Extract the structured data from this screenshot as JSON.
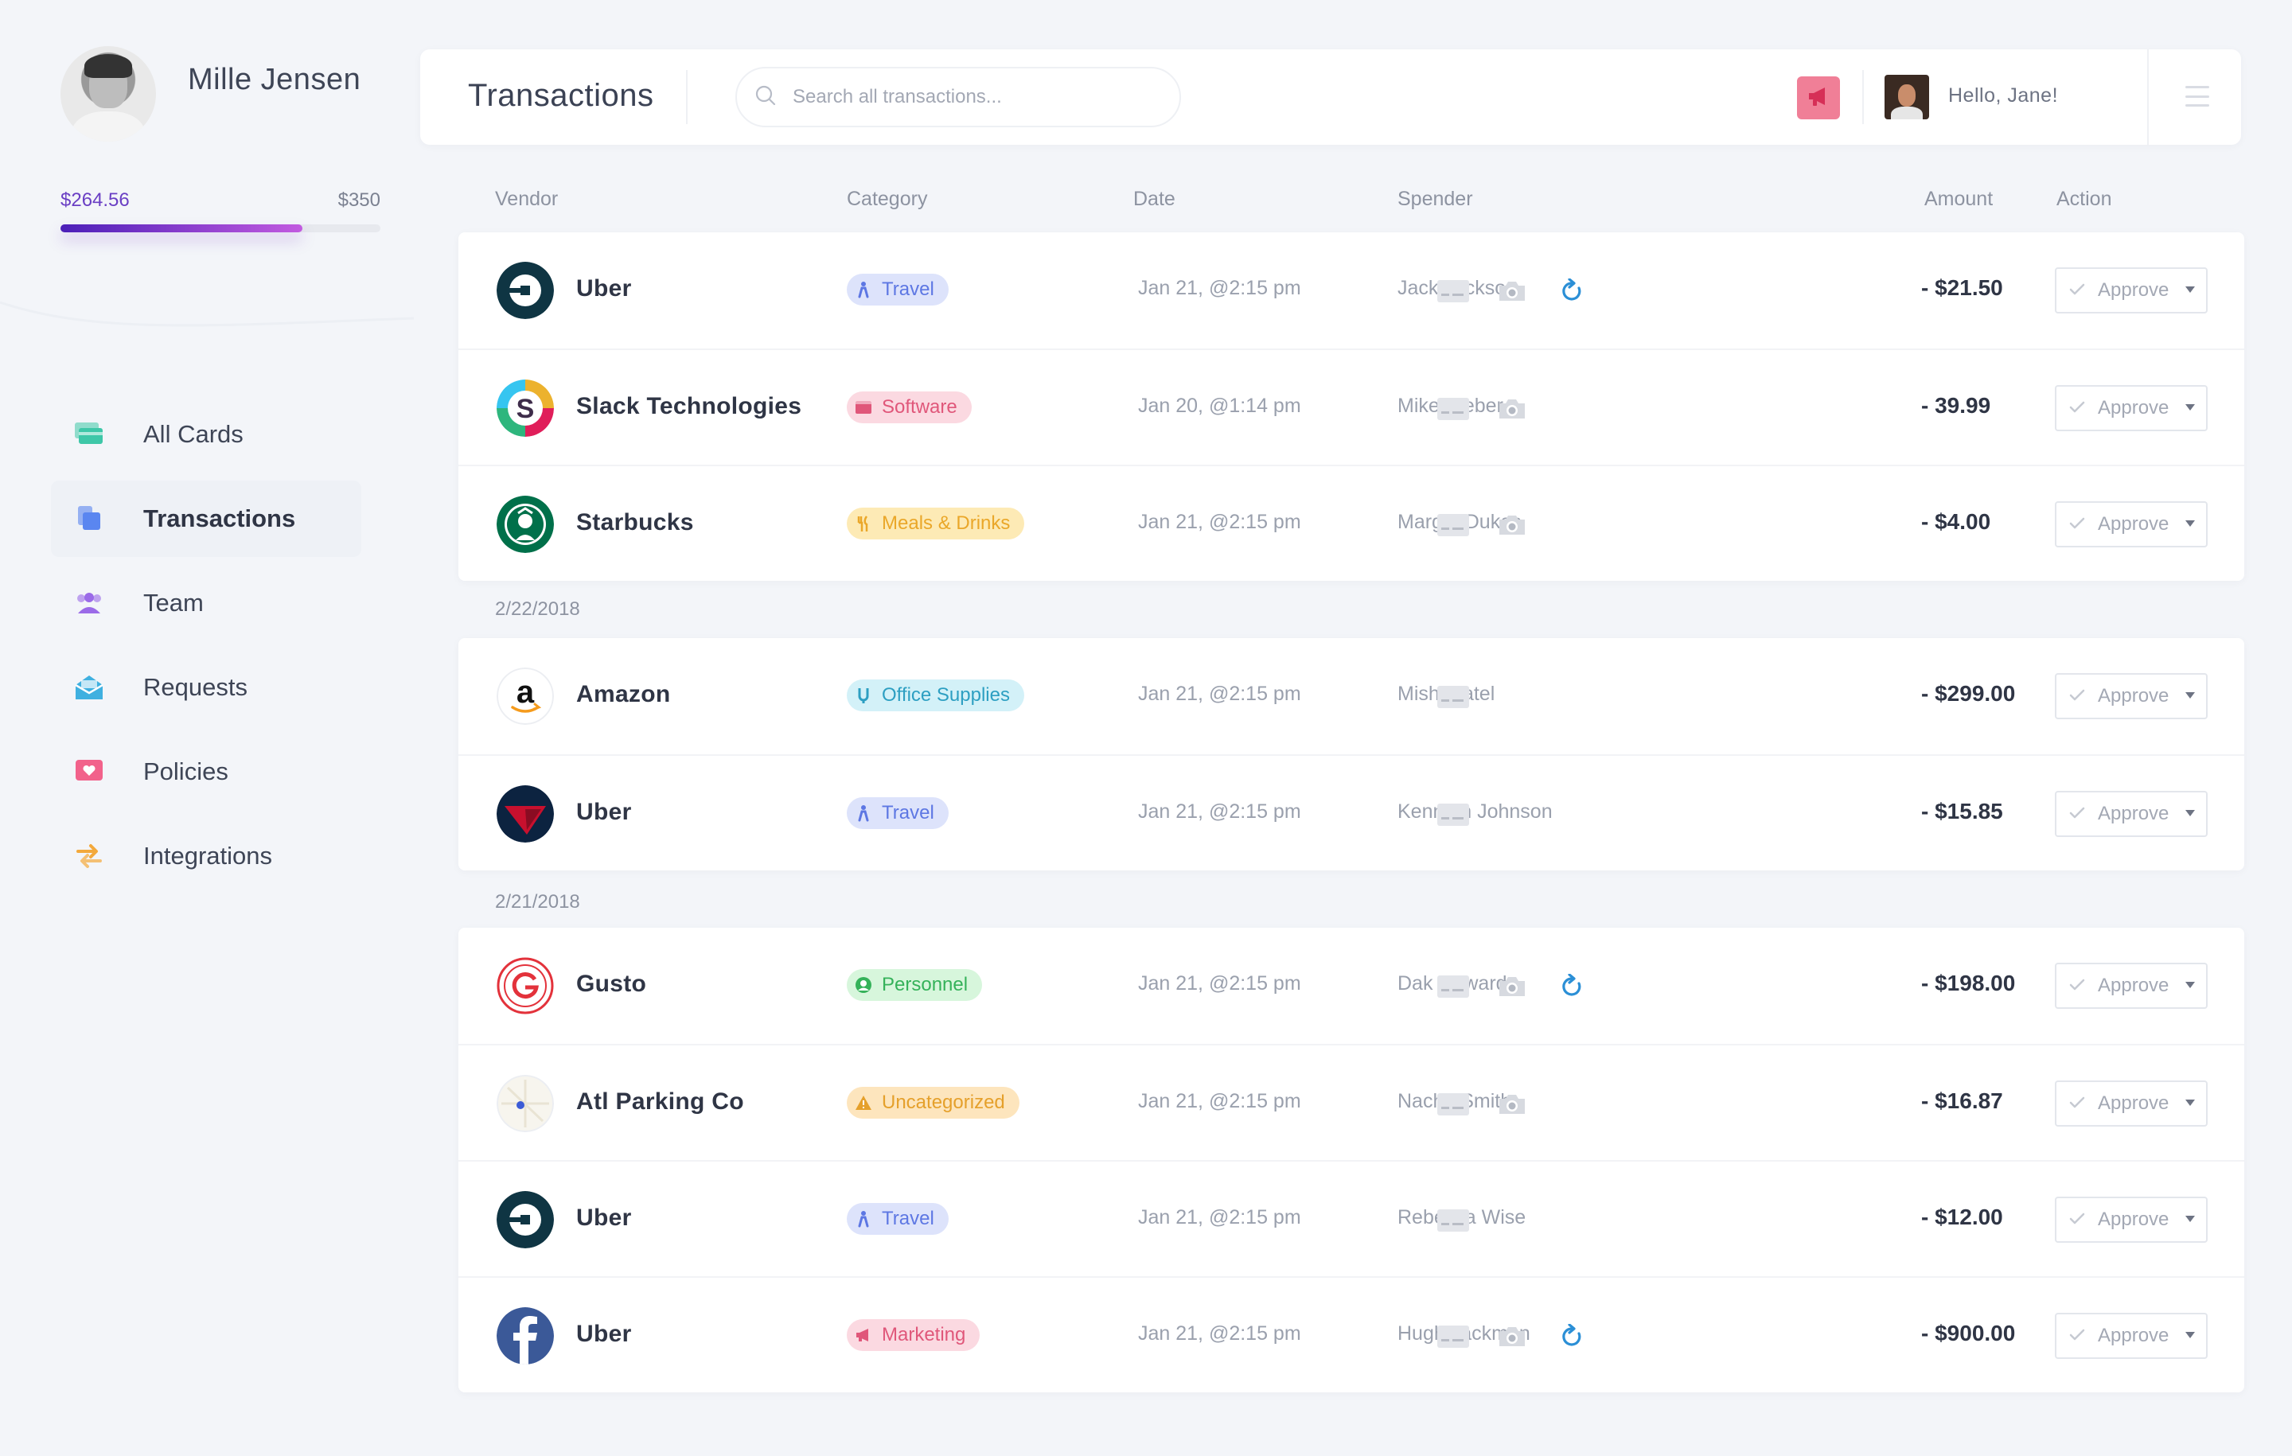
{
  "user": {
    "name": "Mille Jensen"
  },
  "budget": {
    "spent": "$264.56",
    "limit": "$350",
    "fraction": 0.756
  },
  "nav": [
    {
      "label": "All Cards",
      "icon": "cards-icon",
      "color": "#3ec7a8"
    },
    {
      "label": "Transactions",
      "icon": "transactions-icon",
      "color": "#5a86f0",
      "active": true
    },
    {
      "label": "Team",
      "icon": "team-icon",
      "color": "#9b6be8"
    },
    {
      "label": "Requests",
      "icon": "requests-icon",
      "color": "#3fb0e0"
    },
    {
      "label": "Policies",
      "icon": "policies-icon",
      "color": "#f2628b"
    },
    {
      "label": "Integrations",
      "icon": "integrations-icon",
      "color": "#f3a93c"
    }
  ],
  "header": {
    "title": "Transactions",
    "search_placeholder": "Search all transactions...",
    "greeting": "Hello, Jane!",
    "announce_color": "#f07f97"
  },
  "columns": [
    "Vendor",
    "Category",
    "Date",
    "Spender",
    "Amount",
    "Action"
  ],
  "groups": [
    {
      "date": "",
      "rows": [
        {
          "vendor": "Uber",
          "logo": "uber",
          "category": "Travel",
          "cat": "travel",
          "date": "Jan 21,  @2:15 pm",
          "spender": "Jack Jackson",
          "card": true,
          "camera": true,
          "refresh": true,
          "amount": "- $21.50",
          "action": "Approve"
        },
        {
          "vendor": "Slack Technologies",
          "logo": "slack",
          "category": "Software",
          "cat": "software",
          "date": "Jan 20, @1:14 pm",
          "spender": "Mike Weber",
          "card": true,
          "camera": true,
          "refresh": false,
          "amount": "- 39.99",
          "action": "Approve"
        },
        {
          "vendor": "Starbucks",
          "logo": "starbucks",
          "category": "Meals & Drinks",
          "cat": "meals",
          "date": "Jan 21,  @2:15 pm",
          "spender": "Margot Dukes",
          "card": true,
          "camera": true,
          "refresh": false,
          "amount": "- $4.00",
          "action": "Approve"
        }
      ]
    },
    {
      "date": "2/22/2018",
      "rows": [
        {
          "vendor": "Amazon",
          "logo": "amazon",
          "category": "Office Supplies",
          "cat": "office",
          "date": "Jan 21,  @2:15 pm",
          "spender": "Mishi Patel",
          "card": true,
          "camera": false,
          "refresh": false,
          "amount": "- $299.00",
          "action": "Approve"
        },
        {
          "vendor": "Uber",
          "logo": "delta",
          "category": "Travel",
          "cat": "travel",
          "date": "Jan 21,  @2:15 pm",
          "spender": "Kenneth Johnson",
          "card": true,
          "camera": false,
          "refresh": false,
          "amount": "- $15.85",
          "action": "Approve"
        }
      ]
    },
    {
      "date": "2/21/2018",
      "rows": [
        {
          "vendor": "Gusto",
          "logo": "gusto",
          "category": "Personnel",
          "cat": "personnel",
          "date": "Jan 21,  @2:15 pm",
          "spender": "Dak Howard",
          "card": true,
          "camera": true,
          "refresh": true,
          "amount": "- $198.00",
          "action": "Approve"
        },
        {
          "vendor": "Atl Parking Co",
          "logo": "parking",
          "category": "Uncategorized",
          "cat": "uncat",
          "date": "Jan 21,  @2:15 pm",
          "spender": "Nacho Smith",
          "card": true,
          "camera": true,
          "refresh": false,
          "amount": "- $16.87",
          "action": "Approve"
        },
        {
          "vendor": "Uber",
          "logo": "uber",
          "category": "Travel",
          "cat": "travel",
          "date": "Jan 21,  @2:15 pm",
          "spender": "Rebecca Wise",
          "card": true,
          "camera": false,
          "refresh": false,
          "amount": "- $12.00",
          "action": "Approve"
        },
        {
          "vendor": "Uber",
          "logo": "facebook",
          "category": "Marketing",
          "cat": "marketing",
          "date": "Jan 21,  @2:15 pm",
          "spender": "Hugh Jackman",
          "card": true,
          "camera": true,
          "refresh": true,
          "amount": "- $900.00",
          "action": "Approve"
        }
      ]
    }
  ],
  "category_colors": {
    "travel": {
      "bg": "#dde3fb",
      "fg": "#5d77e3"
    },
    "software": {
      "bg": "#fbd9e1",
      "fg": "#e0577a"
    },
    "meals": {
      "bg": "#fdeab5",
      "fg": "#eaa729"
    },
    "office": {
      "bg": "#d3f1f8",
      "fg": "#2d9fc2"
    },
    "personnel": {
      "bg": "#d7f6dc",
      "fg": "#35b25a"
    },
    "uncat": {
      "bg": "#fde5bd",
      "fg": "#e5a02b"
    },
    "marketing": {
      "bg": "#fbd9e1",
      "fg": "#e0577a"
    }
  }
}
